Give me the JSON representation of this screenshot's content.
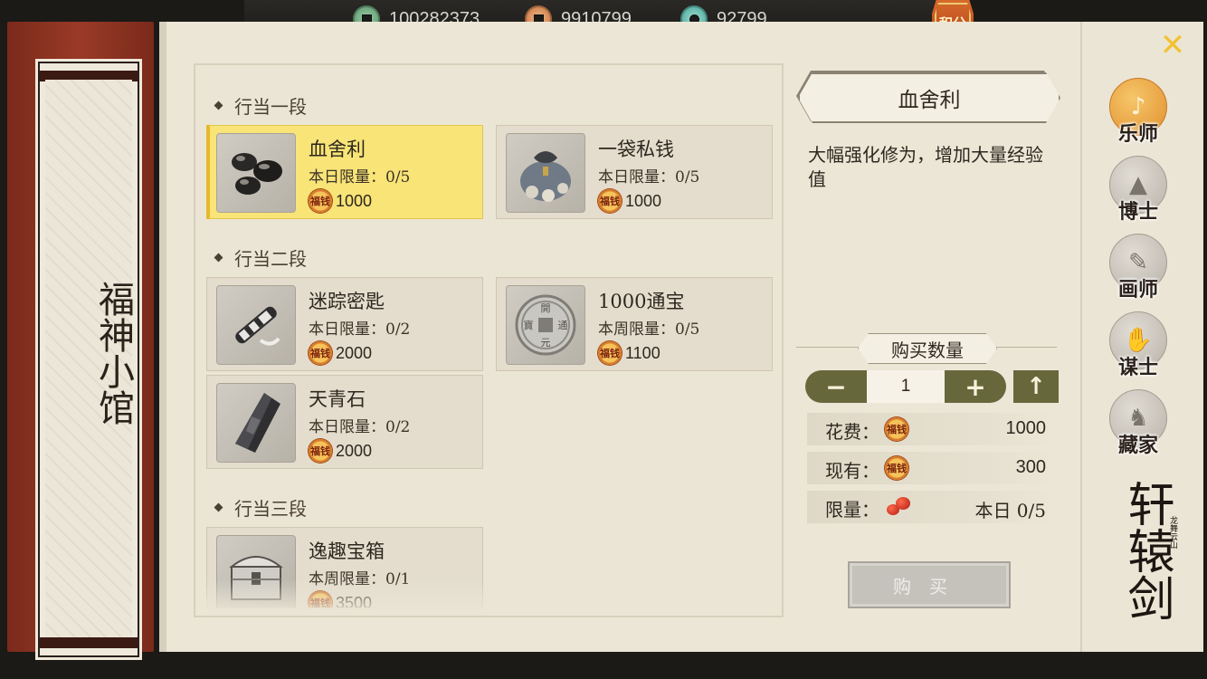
{
  "currencies": [
    {
      "name": "copper-coin",
      "value": "100282373",
      "color": "#6aa27b"
    },
    {
      "name": "bronze-coin",
      "value": "9910799",
      "color": "#d98a52"
    },
    {
      "name": "jade-coin",
      "value": "92799",
      "color": "#53b6a8"
    }
  ],
  "score_badge": "积分",
  "shop_title": "福神小馆",
  "sections": [
    {
      "title": "行当一段"
    },
    {
      "title": "行当二段"
    },
    {
      "title": "行当三段"
    }
  ],
  "items": [
    {
      "name": "血舍利",
      "limit": "本日限量：0/5",
      "price": "1000",
      "icon": "black-beads-icon"
    },
    {
      "name": "一袋私钱",
      "limit": "本日限量：0/5",
      "price": "1000",
      "icon": "money-bag-icon"
    },
    {
      "name": "迷踪密匙",
      "limit": "本日限量：0/2",
      "price": "2000",
      "icon": "scroll-key-icon"
    },
    {
      "name": "1000通宝",
      "limit": "本周限量：0/5",
      "price": "1100",
      "icon": "silver-coin-icon"
    },
    {
      "name": "天青石",
      "limit": "本日限量：0/2",
      "price": "2000",
      "icon": "crystal-icon"
    },
    {
      "name": "逸趣宝箱",
      "limit": "本周限量：0/1",
      "price": "3500",
      "icon": "treasure-chest-icon"
    }
  ],
  "fuqian_label": "福钱",
  "coin_glyph": "開元通寶",
  "detail": {
    "title": "血舍利",
    "description": "大幅强化修为，增加大量经验值",
    "qty_label": "购买数量",
    "qty_value": "1",
    "minus": "−",
    "plus": "+",
    "max": "↑",
    "cost_label": "花费：",
    "cost_value": "1000",
    "own_label": "现有：",
    "own_value": "300",
    "limit_label": "限量：",
    "limit_value": "本日 0/5",
    "buy_label": "购买"
  },
  "tabs": [
    {
      "label": "乐师",
      "active": true,
      "icon": "musician-icon"
    },
    {
      "label": "博士",
      "active": false,
      "icon": "scholar-cap-icon"
    },
    {
      "label": "画师",
      "active": false,
      "icon": "brush-icon"
    },
    {
      "label": "谋士",
      "active": false,
      "icon": "strategist-icon"
    },
    {
      "label": "藏家",
      "active": false,
      "icon": "camel-icon"
    }
  ],
  "logo": {
    "title": "轩辕剑",
    "sub": "龙舞云山"
  }
}
